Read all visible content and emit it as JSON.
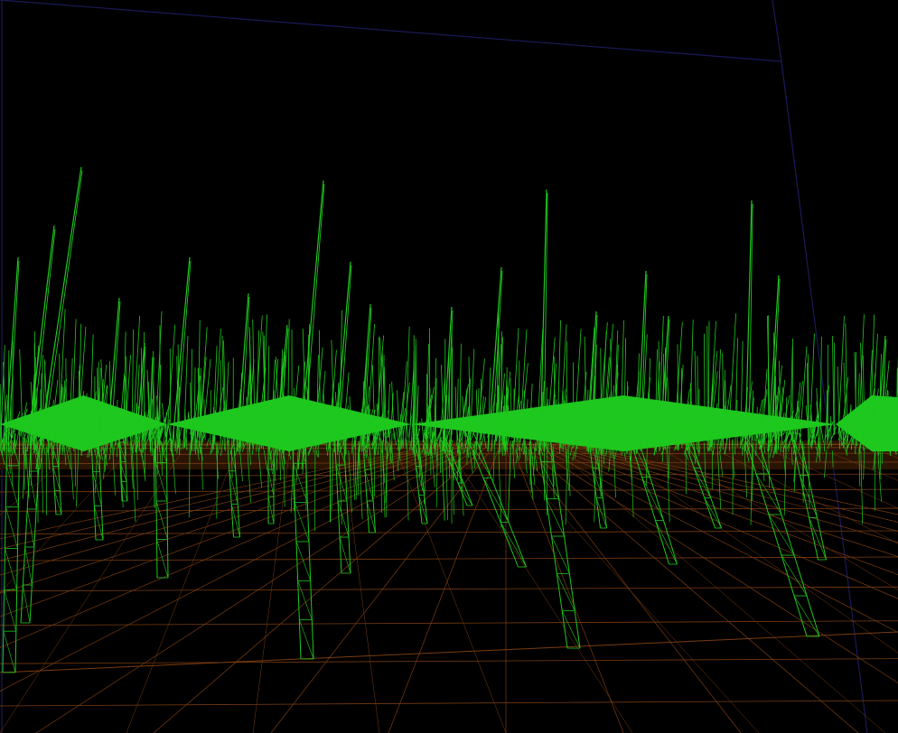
{
  "scene": {
    "view": "wireframe-3d",
    "background_color": "#000000",
    "grass_color": "#1ec81e",
    "ground_color": "#7a3c10",
    "bounds_color": "#1a1a5a"
  }
}
